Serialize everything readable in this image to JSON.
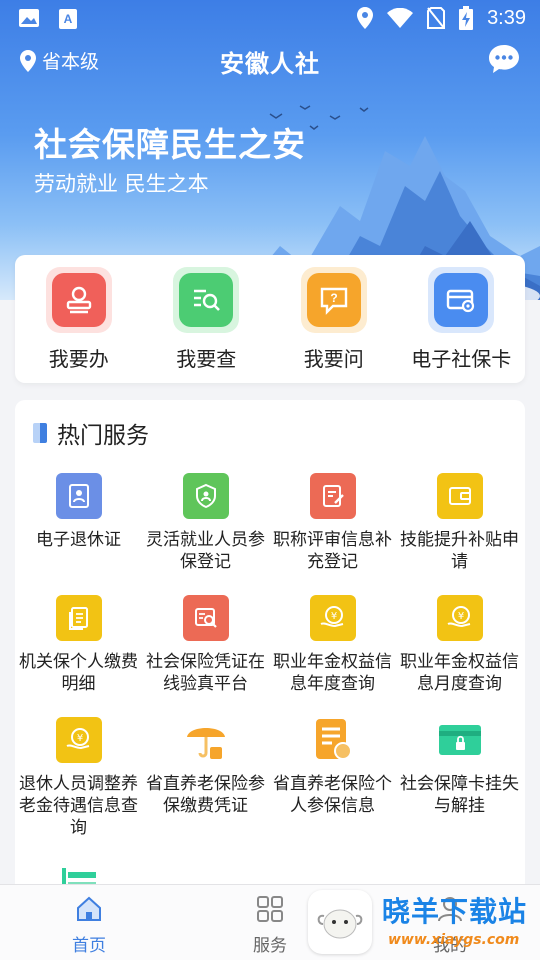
{
  "status_bar": {
    "time": "3:39"
  },
  "header": {
    "location": "省本级",
    "title": "安徽人社"
  },
  "banner": {
    "headline": "社会保障民生之安",
    "subline": "劳动就业 民生之本"
  },
  "quick_actions": [
    {
      "label": "我要办",
      "icon": "stamp-icon",
      "color": "#f0605a"
    },
    {
      "label": "我要查",
      "icon": "search-list-icon",
      "color": "#4ccc73"
    },
    {
      "label": "我要问",
      "icon": "question-chat-icon",
      "color": "#f6a52b"
    },
    {
      "label": "电子社保卡",
      "icon": "card-settings-icon",
      "color": "#4a8cf0"
    }
  ],
  "hot_services": {
    "title": "热门服务",
    "items": [
      {
        "label": "电子退休证",
        "icon": "id-card-icon",
        "color": "#6b8fe6"
      },
      {
        "label": "灵活就业人员参保登记",
        "icon": "shield-user-icon",
        "color": "#5fc55a"
      },
      {
        "label": "职称评审信息补充登记",
        "icon": "edit-doc-icon",
        "color": "#ec6a55"
      },
      {
        "label": "技能提升补贴申请",
        "icon": "wallet-icon",
        "color": "#f2c314"
      },
      {
        "label": "机关保个人缴费明细",
        "icon": "document-icon",
        "color": "#f2c314"
      },
      {
        "label": "社会保险凭证在线验真平台",
        "icon": "verify-search-icon",
        "color": "#ec6a55"
      },
      {
        "label": "职业年金权益信息年度查询",
        "icon": "yuan-hand-icon",
        "color": "#f2c314"
      },
      {
        "label": "职业年金权益信息月度查询",
        "icon": "yuan-hand-icon",
        "color": "#f2c314"
      },
      {
        "label": "退休人员调整养老金待遇信息查询",
        "icon": "yuan-hand-icon",
        "color": "#f2c314"
      },
      {
        "label": "省直养老保险参保缴费凭证",
        "icon": "umbrella-icon",
        "color": "#f6a52b"
      },
      {
        "label": "省直养老保险个人参保信息",
        "icon": "doc-badge-icon",
        "color": "#f6a52b"
      },
      {
        "label": "社会保障卡挂失与解挂",
        "icon": "lock-card-icon",
        "color": "#2fcf9a"
      }
    ]
  },
  "tabbar": [
    {
      "label": "首页",
      "icon": "home-icon",
      "active": true
    },
    {
      "label": "服务",
      "icon": "grid-icon",
      "active": false
    },
    {
      "label": "我的",
      "icon": "user-icon",
      "active": false
    }
  ],
  "watermark": {
    "brand": "晓羊下载站",
    "url": "www.xiaygs.com"
  },
  "colors": {
    "primary": "#3d7ee6",
    "active_tab": "#3f7fe0"
  }
}
